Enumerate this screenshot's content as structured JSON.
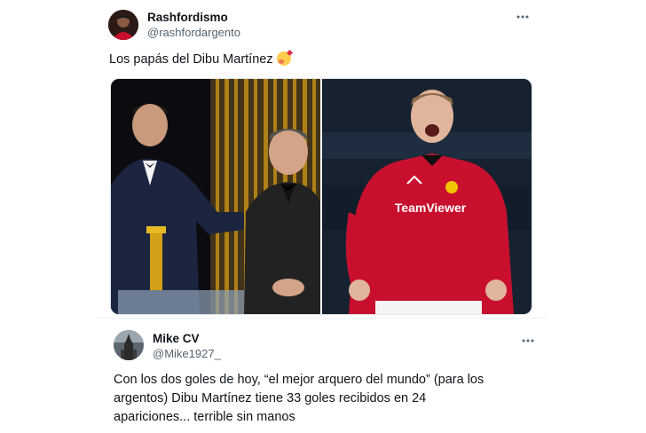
{
  "tweet1": {
    "author_name": "Rashfordismo",
    "author_handle": "@rashfordargento",
    "more_icon": "more-horizontal-icon",
    "text": "Los papás del Dibu Martínez",
    "emoji": "smiling-face-with-hearts-icon",
    "media": {
      "left_photo": "award-ceremony-photo",
      "right_photo": "player-celebrating-photo",
      "jersey_text": "TeamViewer",
      "colors": {
        "jersey_red": "#c8102e",
        "stage_gold": "#b8860b",
        "suit_navy": "#1c2540"
      }
    }
  },
  "tweet2": {
    "author_name": "Mike CV",
    "author_handle": "@Mike1927_",
    "more_icon": "more-horizontal-icon",
    "text": "Con los dos goles de hoy, “el mejor arquero del mundo” (para los argentos) Dibu Martínez tiene 33 goles recibidos en 24 apariciones... terrible sin manos"
  },
  "colors": {
    "text": "#0f1419",
    "secondary": "#536471",
    "divider": "#eff3f4"
  }
}
